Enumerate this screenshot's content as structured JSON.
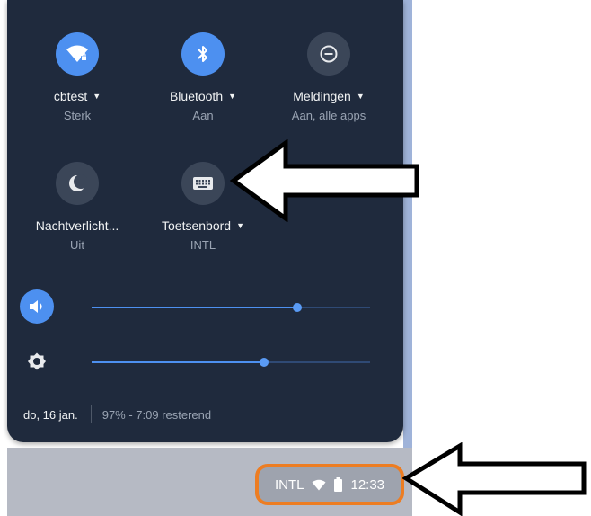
{
  "tiles": [
    {
      "label": "cbtest",
      "sub": "Sterk",
      "icon": "wifi-icon",
      "state": "on"
    },
    {
      "label": "Bluetooth",
      "sub": "Aan",
      "icon": "bluetooth-icon",
      "state": "on"
    },
    {
      "label": "Meldingen",
      "sub": "Aan, alle apps",
      "icon": "do-not-disturb-icon",
      "state": "off"
    },
    {
      "label": "Nachtverlicht...",
      "sub": "Uit",
      "icon": "night-light-icon",
      "state": "off"
    },
    {
      "label": "Toetsenbord",
      "sub": "INTL",
      "icon": "keyboard-icon",
      "state": "off"
    }
  ],
  "sliders": {
    "volume": {
      "icon": "volume-icon",
      "level": 0.74
    },
    "brightness": {
      "icon": "brightness-icon",
      "level": 0.62
    }
  },
  "footer": {
    "date": "do, 16 jan.",
    "battery": "97% - 7:09 resterend"
  },
  "status": {
    "ime": "INTL",
    "time": "12:33",
    "highlight_color": "#ed7d22"
  },
  "colors": {
    "accent": "#4d90f0",
    "panel": "#1f2a3d"
  }
}
